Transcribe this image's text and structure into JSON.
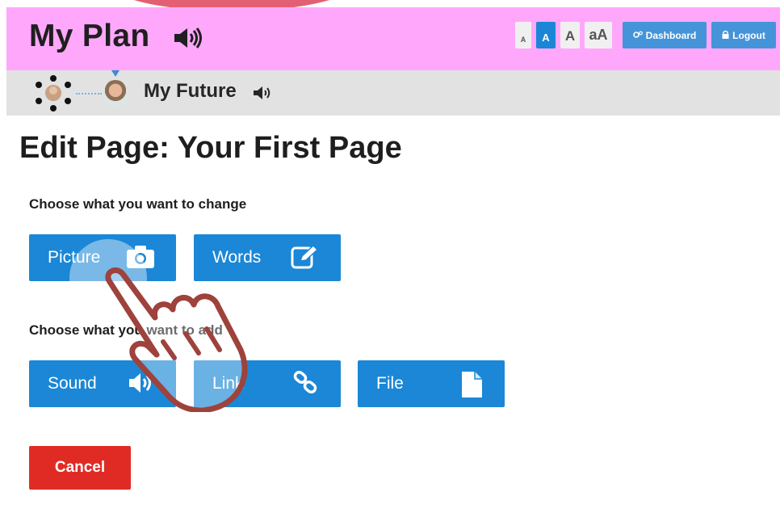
{
  "header": {
    "app_title": "My Plan",
    "text_size_buttons": [
      "A",
      "A",
      "A",
      "aA"
    ],
    "dashboard_label": "Dashboard",
    "logout_label": "Logout",
    "bar_color": "#ffa8fb"
  },
  "breadcrumb": {
    "current": "My Future"
  },
  "main": {
    "page_title": "Edit Page: Your First Page",
    "change_section_label": "Choose what you want to change",
    "change_options": [
      {
        "label": "Picture",
        "icon": "camera-icon"
      },
      {
        "label": "Words",
        "icon": "edit-icon"
      }
    ],
    "add_section_label": "Choose what you want to add",
    "add_options": [
      {
        "label": "Sound",
        "icon": "speaker-icon"
      },
      {
        "label": "Link",
        "icon": "link-icon"
      },
      {
        "label": "File",
        "icon": "file-icon"
      }
    ],
    "cancel_label": "Cancel"
  },
  "colors": {
    "accent_blue": "#1b87d6",
    "cancel_red": "#e02b25"
  }
}
